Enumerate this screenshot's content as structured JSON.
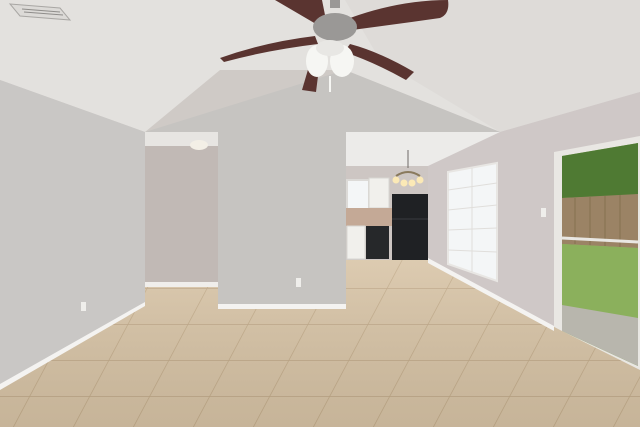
{
  "photo": {
    "subject": "",
    "palette": {
      "ceiling": "#e3e1de",
      "ceiling_shadow": "#cfccc8",
      "wall_left": "#c9c7c5",
      "wall_center": "#c6c4c1",
      "wall_right": "#cfc8c7",
      "wall_dark": "#b9b4b1",
      "floor": "#d8c4a6",
      "floor_grout": "#c1a987",
      "baseboard": "#f4f3f1",
      "fan_blade": "#5a3430",
      "fan_metal": "#9a9896",
      "fan_light": "#f6f6f3",
      "fridge": "#1f2124",
      "dishwasher": "#26282a",
      "cabinet": "#f1f0ec",
      "window_glass": "#f4f6f7",
      "grass": "#8bb05c",
      "fence": "#9b8365",
      "tree": "#4f7a33"
    }
  }
}
